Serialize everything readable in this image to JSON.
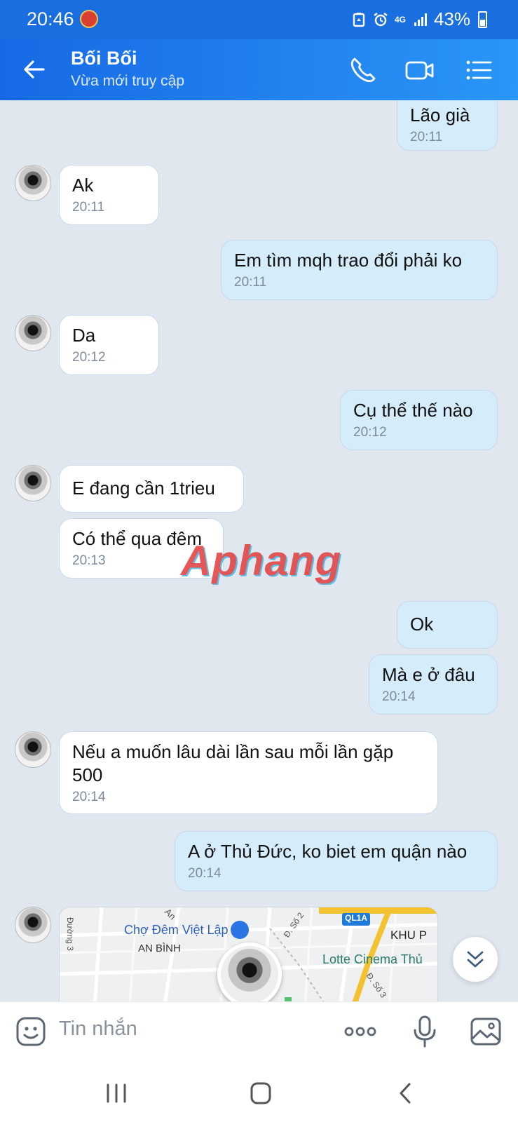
{
  "status_bar": {
    "time": "20:46",
    "network": "4G",
    "battery": "43%"
  },
  "header": {
    "title": "Bối Bối",
    "subtitle": "Vừa mới truy cập"
  },
  "messages": [
    {
      "dir": "out",
      "text": "Lão già",
      "time": "20:11"
    },
    {
      "dir": "in",
      "text": "Ak",
      "time": "20:11"
    },
    {
      "dir": "out",
      "text": "Em tìm mqh trao đổi phải ko",
      "time": "20:11"
    },
    {
      "dir": "in",
      "text": "Da",
      "time": "20:12"
    },
    {
      "dir": "out",
      "text": "Cụ thể thế nào",
      "time": "20:12"
    },
    {
      "dir": "in",
      "text": "E đang cần 1trieu",
      "time": ""
    },
    {
      "dir": "in",
      "text": "Có thể qua đêm",
      "time": "20:13"
    },
    {
      "dir": "out",
      "text": "Ok",
      "time": ""
    },
    {
      "dir": "out",
      "text": "Mà e ở đâu",
      "time": "20:14"
    },
    {
      "dir": "in",
      "text": "Nếu a muốn lâu dài lần sau mỗi lần gặp\n500",
      "time": "20:14"
    },
    {
      "dir": "out",
      "text": "A ở Thủ Đức, ko biet em quận nào",
      "time": "20:14"
    }
  ],
  "watermark": "Aphang",
  "map": {
    "labels": [
      "Chợ Đêm Việt Lập",
      "AN BÌNH",
      "Lotte Cinema Thủ",
      "KHU P",
      "QL1A",
      "Đường 3",
      "Đ. Số 2",
      "Đ. Số 3",
      "An"
    ]
  },
  "input": {
    "placeholder": "Tin nhắn"
  }
}
